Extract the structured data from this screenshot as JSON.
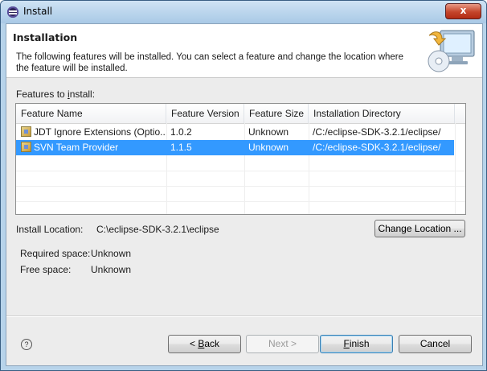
{
  "window": {
    "title": "Install",
    "close_label": "x"
  },
  "banner": {
    "title": "Installation",
    "description": "The following features will be installed. You can select a feature and change the location where the feature will be installed."
  },
  "features": {
    "label_pre": "Features to ",
    "label_mnemonic": "i",
    "label_post": "nstall:",
    "columns": [
      "Feature Name",
      "Feature Version",
      "Feature Size",
      "Installation Directory"
    ],
    "rows": [
      {
        "name": "JDT Ignore Extensions (Optio...",
        "version": "1.0.2",
        "size": "Unknown",
        "dir": "/C:/eclipse-SDK-3.2.1/eclipse/",
        "selected": false
      },
      {
        "name": "SVN Team Provider",
        "version": "1.1.5",
        "size": "Unknown",
        "dir": "/C:/eclipse-SDK-3.2.1/eclipse/",
        "selected": true
      }
    ]
  },
  "install_location": {
    "label": "Install Location:",
    "value": "C:\\eclipse-SDK-3.2.1\\eclipse",
    "change_button": "Change Location ..."
  },
  "space": {
    "required_label": "Required space:",
    "required_value": "Unknown",
    "free_label": "Free space:",
    "free_value": "Unknown"
  },
  "footer": {
    "help_icon": "?",
    "back_pre": "< ",
    "back_mnemonic": "B",
    "back_post": "ack",
    "next_label": "Next >",
    "finish_mnemonic": "F",
    "finish_post": "inish",
    "cancel_label": "Cancel"
  },
  "colors": {
    "selection": "#3399ff",
    "titlebar": "#b7d3ea",
    "dialog_bg": "#ececec"
  }
}
